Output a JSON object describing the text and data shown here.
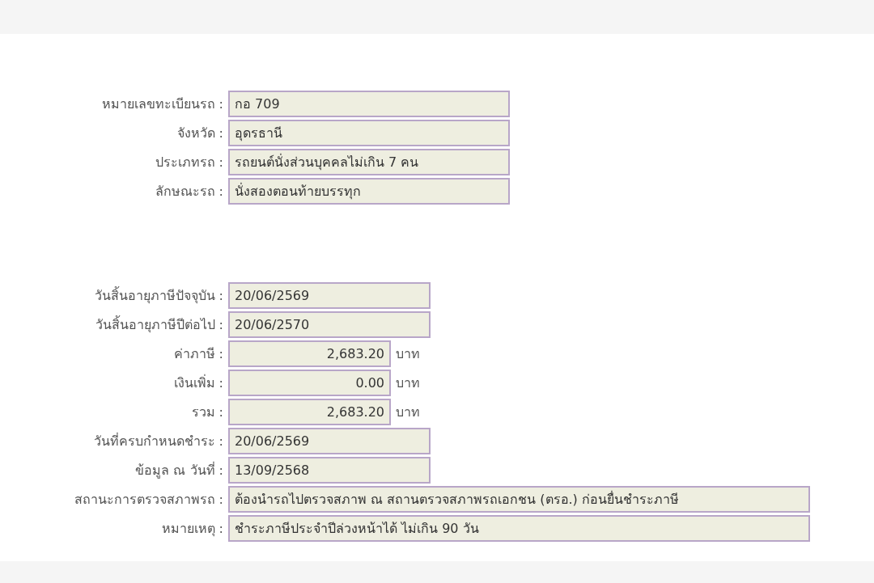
{
  "sections": [
    {
      "rows": [
        {
          "label": "หมายเลขทะเบียนรถ :",
          "value": "กอ 709",
          "kind": "medium"
        },
        {
          "label": "จังหวัด :",
          "value": "อุดรธานี",
          "kind": "medium"
        },
        {
          "label": "ประเภทรถ :",
          "value": "รถยนต์นั่งส่วนบุคคลไม่เกิน 7 คน",
          "kind": "medium"
        },
        {
          "label": "ลักษณะรถ :",
          "value": "นั่งสองตอนท้ายบรรทุก",
          "kind": "medium"
        }
      ]
    },
    {
      "rows": [
        {
          "label": "วันสิ้นอายุภาษีปัจจุบัน :",
          "value": "20/06/2569",
          "kind": "date"
        },
        {
          "label": "วันสิ้นอายุภาษีปีต่อไป :",
          "value": "20/06/2570",
          "kind": "date"
        },
        {
          "label": "ค่าภาษี :",
          "value": "2,683.20",
          "kind": "money",
          "unit": "บาท"
        },
        {
          "label": "เงินเพิ่ม :",
          "value": "0.00",
          "kind": "money",
          "unit": "บาท"
        },
        {
          "label": "รวม :",
          "value": "2,683.20",
          "kind": "money",
          "unit": "บาท"
        },
        {
          "label": "วันที่ครบกำหนดชำระ :",
          "value": "20/06/2569",
          "kind": "date"
        },
        {
          "label": "ข้อมูล ณ วันที่ :",
          "value": "13/09/2568",
          "kind": "date"
        },
        {
          "label": "สถานะการตรวจสภาพรถ :",
          "value": "ต้องนำรถไปตรวจสภาพ ณ สถานตรวจสภาพรถเอกชน (ตรอ.) ก่อนยื่นชำระภาษี",
          "kind": "wide"
        },
        {
          "label": "หมายเหตุ :",
          "value": "ชำระภาษีประจำปีล่วงหน้าได้ ไม่เกิน 90 วัน",
          "kind": "wide"
        }
      ]
    }
  ]
}
